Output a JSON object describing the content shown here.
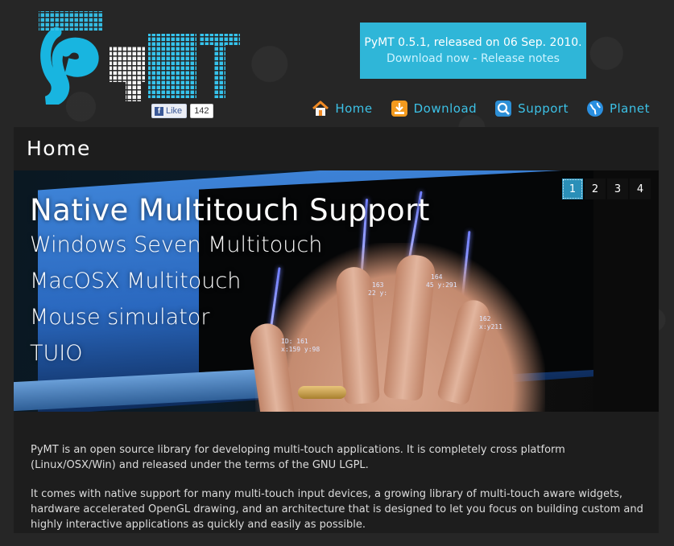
{
  "site": {
    "logo_name": "PyMT",
    "facebook": {
      "like_label": "Like",
      "like_count": "142"
    }
  },
  "release": {
    "announcement": "PyMT 0.5.1, released on 06 Sep. 2010.",
    "download_link": "Download now",
    "separator": " - ",
    "notes_link": "Release notes"
  },
  "nav": {
    "items": [
      {
        "label": "Home",
        "icon": "home-icon"
      },
      {
        "label": "Download",
        "icon": "download-icon"
      },
      {
        "label": "Support",
        "icon": "support-icon"
      },
      {
        "label": "Planet",
        "icon": "globe-icon"
      }
    ]
  },
  "page": {
    "title": "Home"
  },
  "slider": {
    "headline": "Native Multitouch Support",
    "lines": [
      "Windows Seven Multitouch",
      "MacOSX Multitouch",
      "Mouse simulator",
      "TUIO"
    ],
    "pages": [
      "1",
      "2",
      "3",
      "4"
    ],
    "active_page": "1",
    "touch_labels": [
      "ID: 161",
      "x:159 y:98",
      "163",
      "22 y:",
      "164",
      "45 y:291",
      "162",
      "x:y211"
    ]
  },
  "body": {
    "paragraphs": [
      "PyMT is an open source library for developing multi-touch applications. It is completely cross platform (Linux/OSX/Win) and released under the terms of the GNU LGPL.",
      "It comes with native support for many multi-touch input devices, a growing library of multi-touch aware widgets, hardware accelerated OpenGL drawing, and an architecture that is designed to let you focus on building custom and highly interactive applications as quickly and easily as possible."
    ]
  },
  "colors": {
    "accent": "#2fb6d8",
    "nav_text": "#3cc1e6",
    "background": "#262626",
    "panel": "#1d1d1d"
  }
}
